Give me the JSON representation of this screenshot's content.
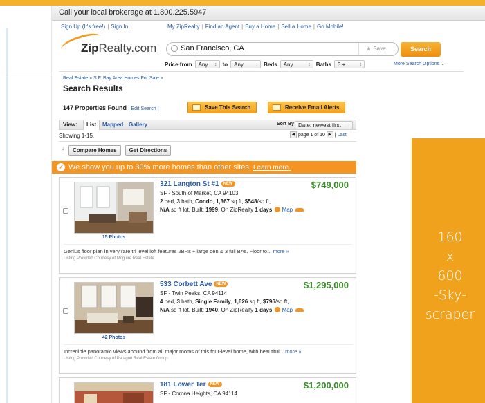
{
  "header": {
    "phone_text": "Call your local brokerage at 1.800.225.5947",
    "links_left": [
      "Sign Up (It's free!)",
      "Sign In"
    ],
    "links_right": [
      "My ZipRealty",
      "Find an Agent",
      "Buy a Home",
      "Sell a Home",
      "Go Mobile!"
    ],
    "logo_zip": "Zip",
    "logo_realty": "Realty.com",
    "search_value": "San Francisco, CA",
    "save_label": "Save",
    "search_button": "Search",
    "more_options": "More Search Options"
  },
  "filters": {
    "price_from_label": "Price from",
    "price_from_value": "Any",
    "to_label": "to",
    "to_value": "Any",
    "beds_label": "Beds",
    "beds_value": "Any",
    "baths_label": "Baths",
    "baths_value": "3 +"
  },
  "results": {
    "breadcrumb": "Real Estate  »  S.F. Bay Area Homes For Sale  »",
    "title": "Search Results",
    "found_text": "147 Properties Found",
    "edit_search": "[ Edit Search ]",
    "save_search": "Save This Search",
    "email_alerts": "Receive Email Alerts",
    "view_label": "View:",
    "tabs": [
      "List",
      "Mapped",
      "Gallery"
    ],
    "sort_label": "Sort By",
    "sort_value": "Date: newest first",
    "showing": "Showing 1-15.",
    "pager_text": "page 1 of 10",
    "pager_last": "Last",
    "compare_button": "Compare Homes",
    "directions_button": "Get Directions",
    "banner_text": "We show you up to 30% more homes than other sites.",
    "banner_link": "Learn more."
  },
  "listings": [
    {
      "address": "321 Langton St #1",
      "badge": "NEW",
      "price": "$749,000",
      "area": "SF - South of Market, CA 94103",
      "beds": "2",
      "baths": "3",
      "type": "Condo",
      "sqft": "1,367",
      "ppsf": "$548",
      "lot": "N/A",
      "built": "1999",
      "days": "1 days",
      "photos": "15 Photos",
      "description": "Genius floor plan in very rare tri level loft features 2BRs + large den & 3 full BAs. Floor to...",
      "more": "more »",
      "courtesy": "Listing Provided Courtesy of Mcguire Real Estate"
    },
    {
      "address": "533 Corbett Ave",
      "badge": "NEW",
      "price": "$1,295,000",
      "area": "SF - Twin Peaks, CA 94114",
      "beds": "4",
      "baths": "3",
      "type": "Single Family",
      "sqft": "1,626",
      "ppsf": "$796",
      "lot": "N/A",
      "built": "1940",
      "days": "1 days",
      "photos": "42 Photos",
      "description": "Incredible panoramic views abound from all major rooms of this four-level home, with beautiful...",
      "more": "more »",
      "courtesy": "Listing Provided Courtesy of Paragon Real Estate Group"
    },
    {
      "address": "181 Lower Ter",
      "badge": "NEW",
      "price": "$1,200,000",
      "area": "SF - Corona Heights, CA 94114"
    }
  ],
  "ad": {
    "lines": [
      "160",
      "x",
      "600",
      "-Sky-",
      "scraper"
    ],
    "color": "#f0a21c"
  },
  "colors": {
    "accent_orange": "#f39423",
    "price_green": "#3a8d2a",
    "link_blue": "#2a5aa3"
  }
}
